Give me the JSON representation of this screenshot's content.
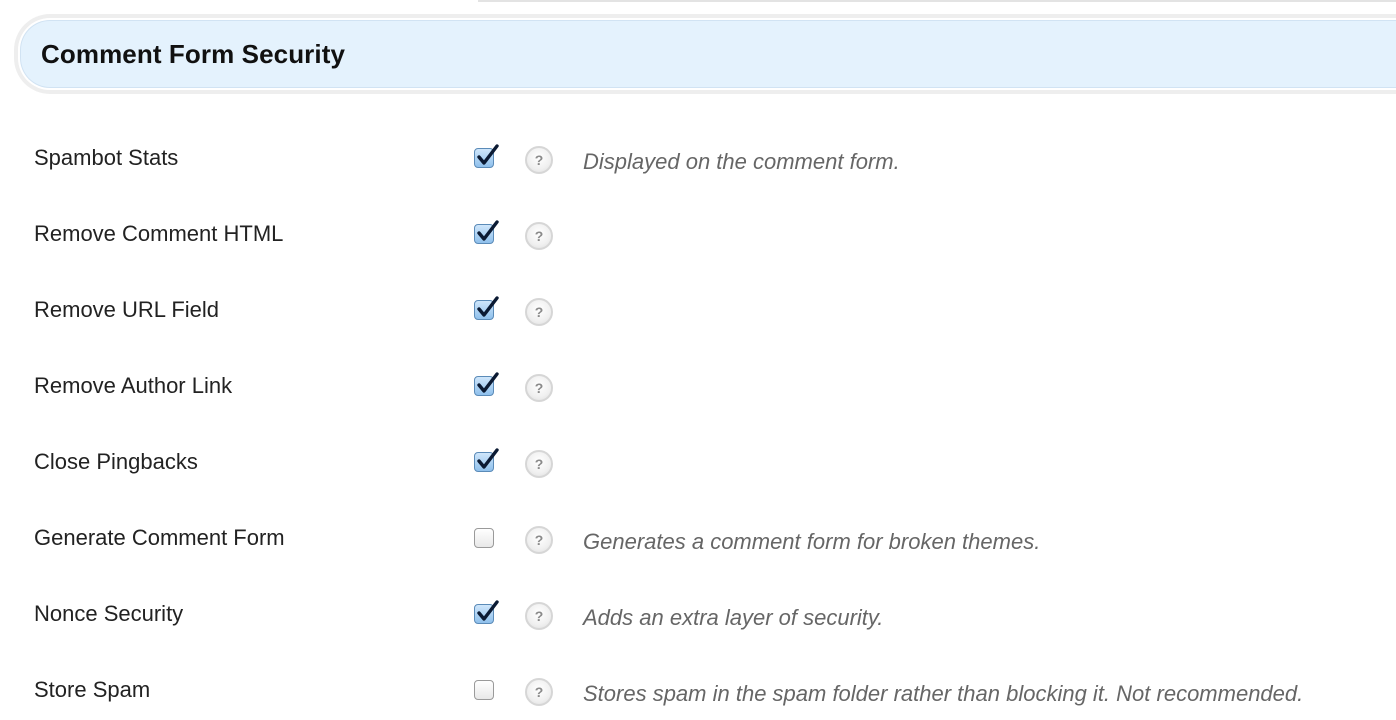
{
  "section": {
    "title": "Comment Form Security"
  },
  "colors": {
    "header_bg": "#e4f2fd",
    "checkbox_checked": "#8fc0ec",
    "description_text": "#666666"
  },
  "help_icon_glyph": "?",
  "rows": [
    {
      "label": "Spambot Stats",
      "checked": true,
      "description": "Displayed on the comment form."
    },
    {
      "label": "Remove Comment HTML",
      "checked": true,
      "description": ""
    },
    {
      "label": "Remove URL Field",
      "checked": true,
      "description": ""
    },
    {
      "label": "Remove Author Link",
      "checked": true,
      "description": ""
    },
    {
      "label": "Close Pingbacks",
      "checked": true,
      "description": ""
    },
    {
      "label": "Generate Comment Form",
      "checked": false,
      "description": "Generates a comment form for broken themes."
    },
    {
      "label": "Nonce Security",
      "checked": true,
      "description": "Adds an extra layer of security."
    },
    {
      "label": "Store Spam",
      "checked": false,
      "description": "Stores spam in the spam folder rather than blocking it. Not recommended."
    }
  ]
}
